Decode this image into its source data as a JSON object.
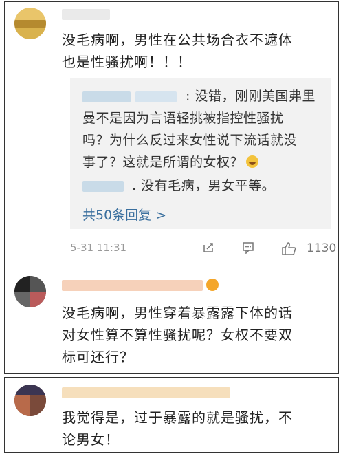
{
  "comments": [
    {
      "text_line1": "没毛病啊，男性在公共场合衣不遮体",
      "text_line2": "也是性骚扰啊！！！",
      "reply": {
        "line1": ": 没错，刚刚美国弗里",
        "line2": "曼不是因为言语轻挑被指控性骚扰",
        "line3": "吗？为什么反过来女性说下流话就没",
        "line4": "事了？这就是所谓的女权？",
        "line5": ". 没有毛病，男女平等。",
        "link": "共50条回复 >"
      },
      "time": "5-31 11:31",
      "likes": "1130",
      "icons": [
        "share-icon",
        "comment-icon",
        "like-icon"
      ]
    },
    {
      "text_line1": "没毛病啊，男性穿着暴露露下体的话",
      "text_line2": "对女性算不算性骚扰呢？女权不要双",
      "text_line3": "标可还行？"
    },
    {
      "text_line1": "我觉得是，过于暴露的就是骚扰，不",
      "text_line2": "论男女！"
    }
  ]
}
